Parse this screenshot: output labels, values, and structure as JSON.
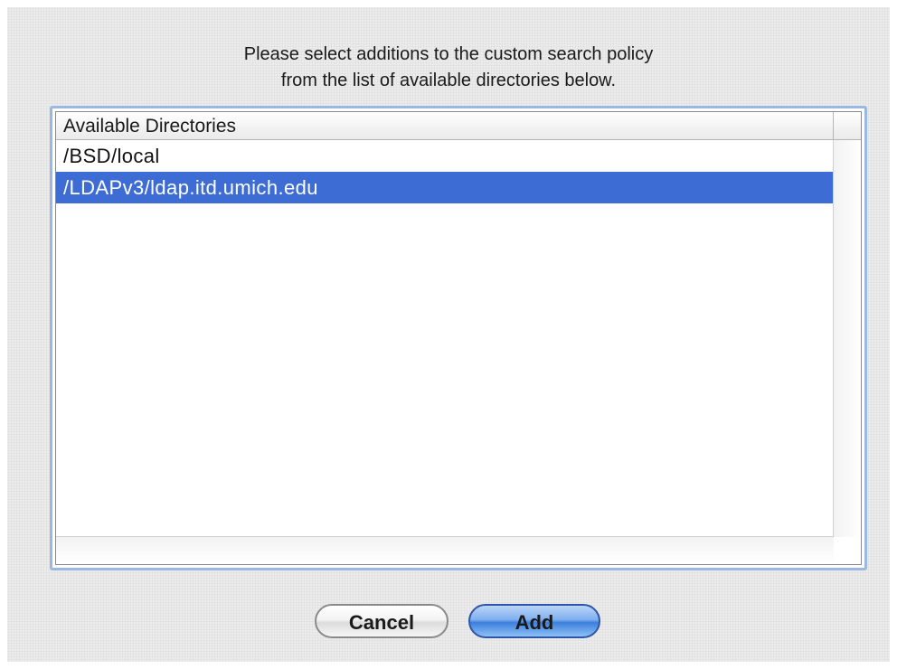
{
  "dialog": {
    "prompt_line1": "Please select additions to the custom search policy",
    "prompt_line2": "from the list of available directories below."
  },
  "directory_list": {
    "column_header": "Available Directories",
    "items": [
      {
        "label": "/BSD/local",
        "selected": false
      },
      {
        "label": "/LDAPv3/ldap.itd.umich.edu",
        "selected": true
      }
    ]
  },
  "buttons": {
    "cancel_label": "Cancel",
    "add_label": "Add"
  },
  "colors": {
    "selection": "#3d6dd4",
    "focus_ring": "#9bb8e3",
    "default_button": "#3c7fdc"
  }
}
